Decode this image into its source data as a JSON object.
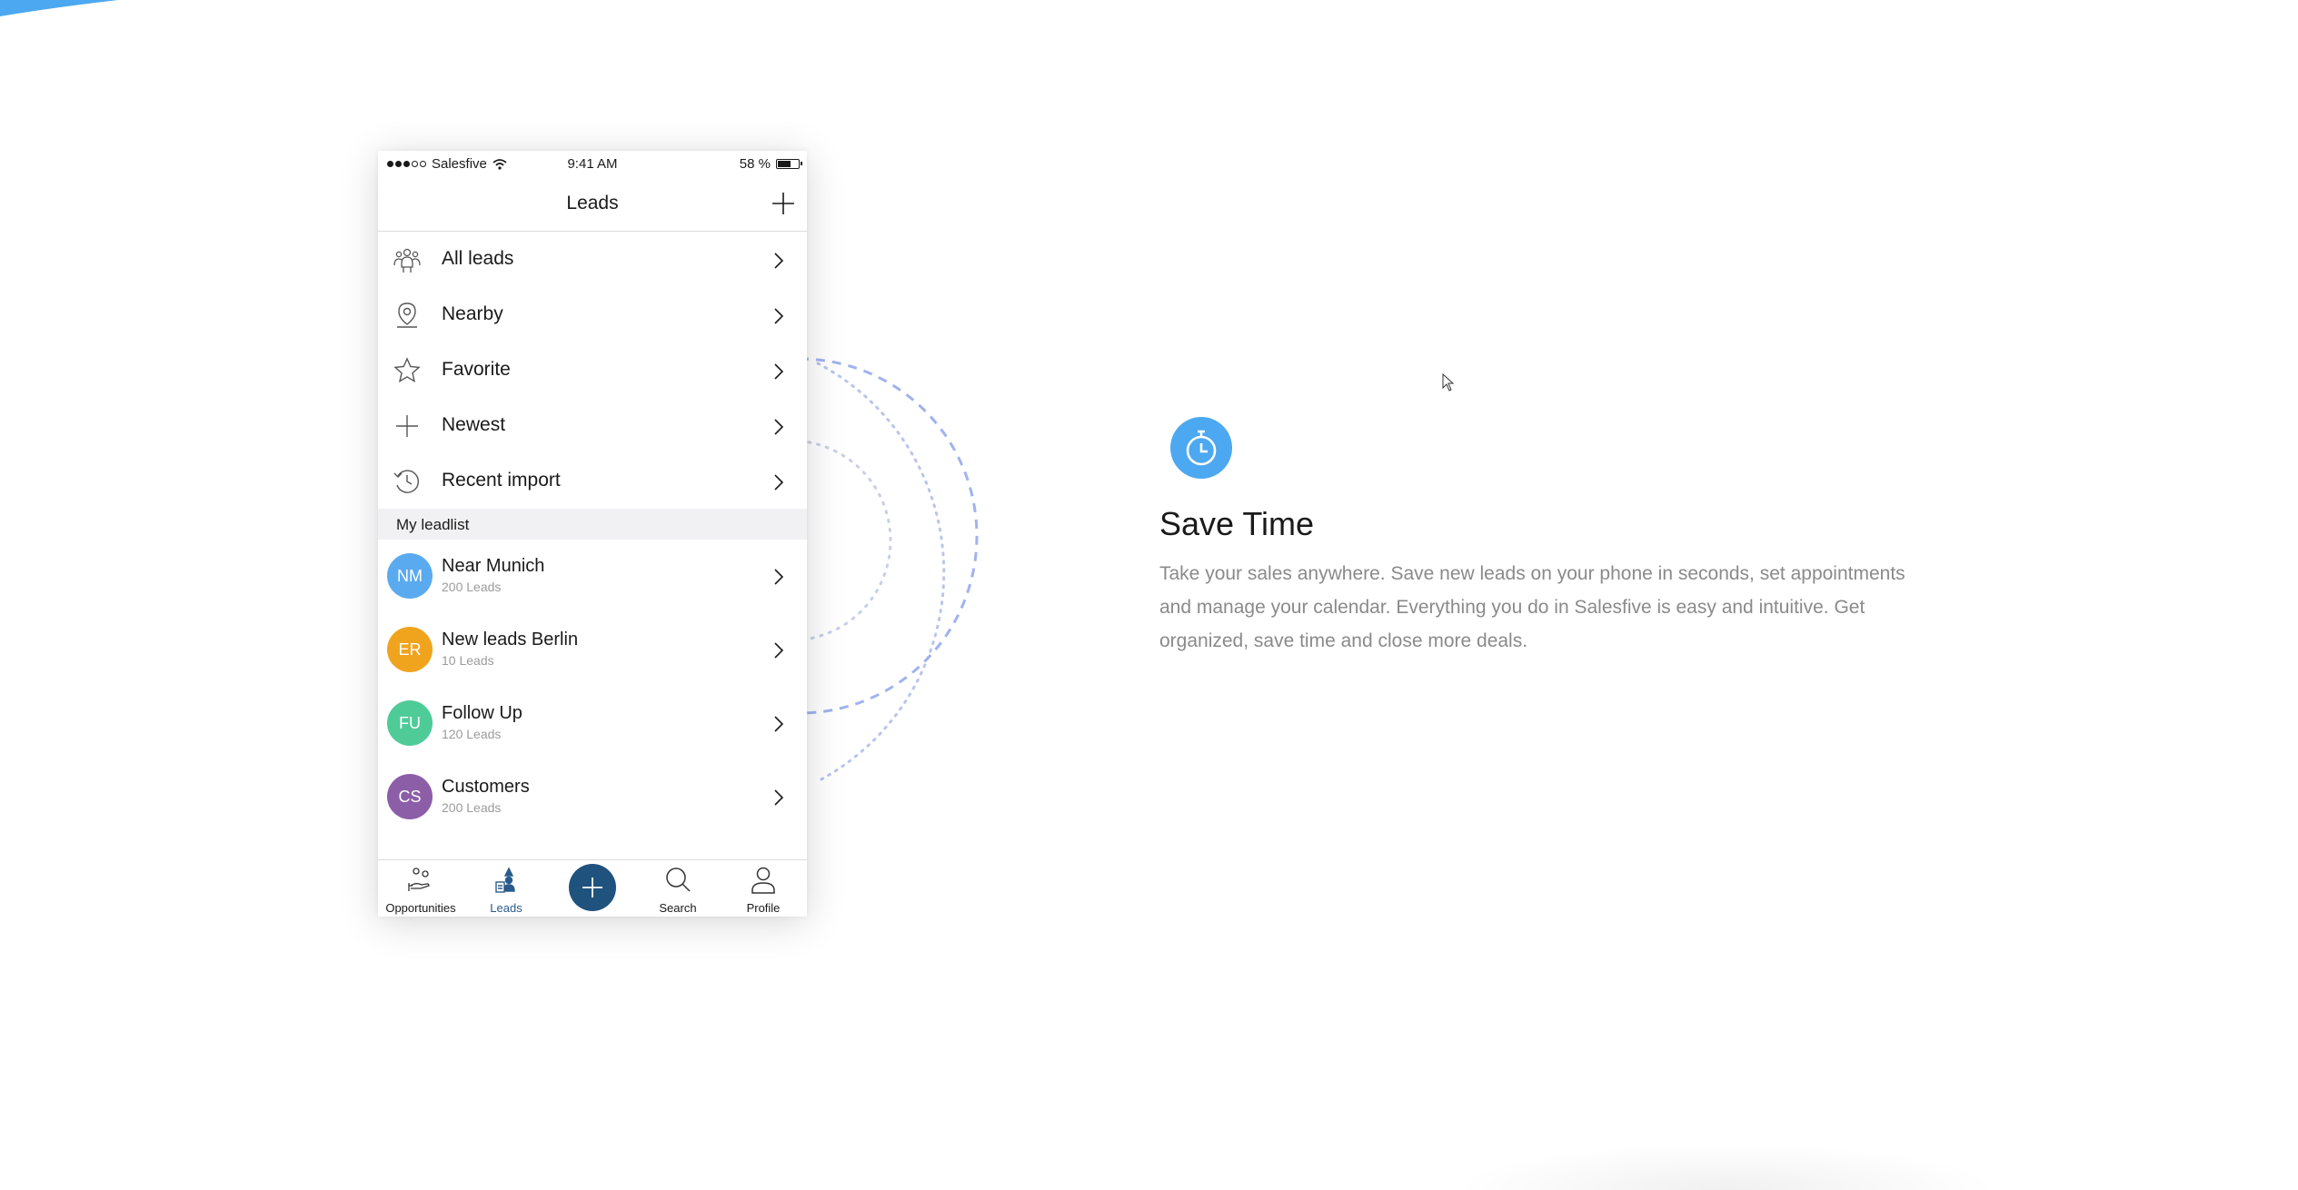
{
  "status_bar": {
    "carrier": "Salesfive",
    "time": "9:41 AM",
    "battery": "58 %",
    "battery_level": 0.58
  },
  "nav": {
    "title": "Leads"
  },
  "menu": [
    {
      "label": "All leads",
      "icon": "people-group-icon"
    },
    {
      "label": "Nearby",
      "icon": "location-pin-icon"
    },
    {
      "label": "Favorite",
      "icon": "star-icon"
    },
    {
      "label": "Newest",
      "icon": "plus-icon"
    },
    {
      "label": "Recent import",
      "icon": "history-icon"
    }
  ],
  "section": {
    "title": "My leadlist"
  },
  "leadlist": [
    {
      "initials": "NM",
      "name": "Near Munich",
      "count": "200 Leads",
      "color": "#5aaaf0"
    },
    {
      "initials": "ER",
      "name": "New leads Berlin",
      "count": "10 Leads",
      "color": "#f0a41e"
    },
    {
      "initials": "FU",
      "name": "Follow Up",
      "count": "120 Leads",
      "color": "#4fcb98"
    },
    {
      "initials": "CS",
      "name": "Customers",
      "count": "200 Leads",
      "color": "#8c5ea8"
    }
  ],
  "tabs": {
    "opportunities": "Opportunities",
    "leads": "Leads",
    "search": "Search",
    "profile": "Profile"
  },
  "feature": {
    "title": "Save Time",
    "description": "Take your sales anywhere. Save new leads on your phone in seconds, set appointments and manage your calendar. Everything you do in Salesfive is easy and intuitive. Get organized, save time and close more deals."
  },
  "colors": {
    "accent": "#4ca8f0",
    "tab_active": "#2a5b8c",
    "fab": "#20527e"
  }
}
